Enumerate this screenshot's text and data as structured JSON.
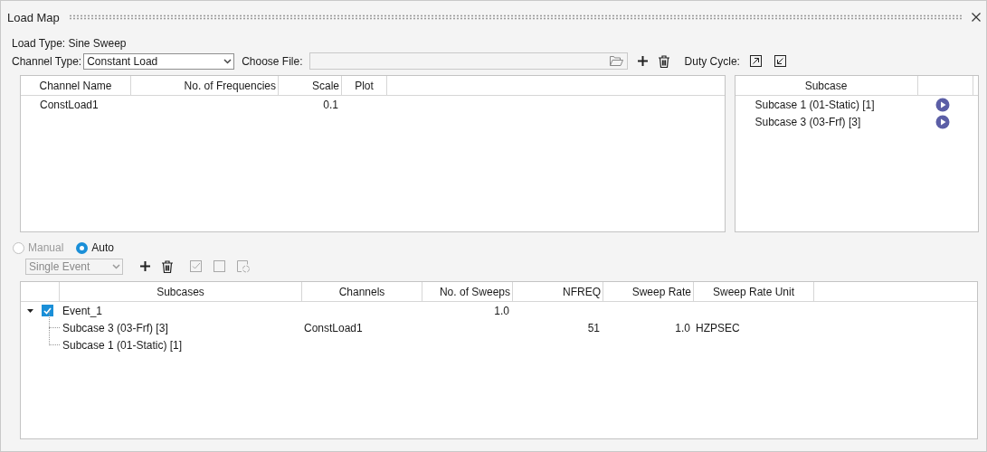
{
  "window": {
    "title": "Load Map"
  },
  "load_type": "Load Type: Sine Sweep",
  "channel_type": {
    "label": "Channel Type:",
    "value": "Constant Load"
  },
  "choose_file": {
    "label": "Choose File:"
  },
  "duty_cycle": {
    "label": "Duty Cycle:"
  },
  "channel_table": {
    "columns": [
      "Channel Name",
      "No. of Frequencies",
      "Scale",
      "Plot"
    ],
    "rows": [
      {
        "channel_name": "ConstLoad1",
        "scale": "0.1"
      }
    ]
  },
  "subcase_list": {
    "column": "Subcase",
    "items": [
      {
        "label": "Subcase 1 (01-Static) [1]"
      },
      {
        "label": "Subcase 3 (03-Frf) [3]"
      }
    ]
  },
  "mode": [
    {
      "label": "Manual",
      "selected": false,
      "disabled": true
    },
    {
      "label": "Auto",
      "selected": true,
      "disabled": false
    }
  ],
  "event_type": {
    "value": "Single Event",
    "disabled": true
  },
  "event_tools": [
    {
      "kind": "add",
      "disabled": false
    },
    {
      "kind": "delete",
      "disabled": false
    },
    {
      "kind": "check-all",
      "disabled": true
    },
    {
      "kind": "uncheck-all",
      "disabled": true
    },
    {
      "kind": "refresh",
      "disabled": true
    }
  ],
  "events": {
    "columns": [
      "Subcases",
      "Channels",
      "No. of Sweeps",
      "NFREQ",
      "Sweep Rate",
      "Sweep Rate Unit"
    ],
    "rows": [
      {
        "subcases": "Event_1",
        "expanded": true,
        "checked": true,
        "no_of_sweeps": "1.0",
        "children": [
          {
            "subcases": "Subcase 3 (03-Frf) [3]",
            "channels": "ConstLoad1",
            "nfreq": "51",
            "sweep_rate": "1.0",
            "sweep_rate_unit": "HZPSEC"
          },
          {
            "subcases": "Subcase 1 (01-Static) [1]"
          }
        ]
      }
    ]
  }
}
